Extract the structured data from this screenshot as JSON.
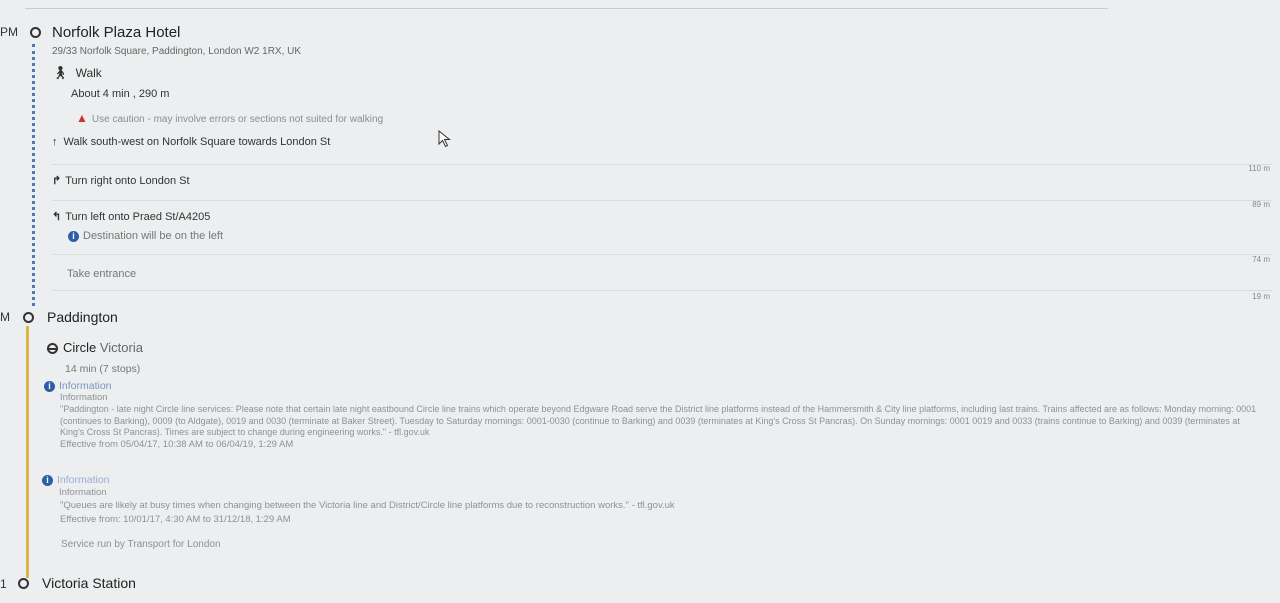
{
  "journey": {
    "origin": {
      "time_suffix": "PM",
      "name": "Norfolk Plaza Hotel",
      "address": "29/33 Norfolk Square, Paddington, London W2 1RX, UK"
    },
    "walk": {
      "mode_label": "Walk",
      "summary": "About 4 min , 290 m",
      "caution": "Use caution - may involve errors or sections not suited for walking",
      "steps": [
        {
          "text": "Walk south-west on Norfolk Square towards London St",
          "icon": "arrow-up-icon",
          "distance": "110 m"
        },
        {
          "text": "Turn right onto London St",
          "icon": "turn-right-icon",
          "distance": "89 m"
        },
        {
          "text": "Turn left onto Praed St/A4205",
          "icon": "turn-left-icon",
          "note": "Destination will be on the left",
          "distance": "74 m"
        },
        {
          "text": "Take entrance",
          "icon": "",
          "distance": "19 m"
        }
      ]
    },
    "transfer": {
      "time_suffix": "M",
      "name": "Paddington",
      "line": "Circle",
      "direction": "Victoria",
      "duration": "14 min (7 stops)",
      "alerts": [
        {
          "heading": "Information",
          "subheading": "Information",
          "body": "\"Paddington - late night Circle line services: Please note that certain late night eastbound Circle line trains which operate beyond Edgware Road serve the District line platforms instead of the Hammersmith & City line platforms, including last trains. Trains affected are as follows: Monday morning: 0001 (continues to Barking), 0009 (to Aldgate), 0019 and 0030 (terminate at Baker Street). Tuesday to Saturday mornings: 0001-0030 (continue to Barking) and 0039 (terminates at King's Cross St Pancras). On Sunday mornings: 0001 0019 and 0033 (trains continue to Barking) and 0039 (terminates at King's Cross St Pancras). Times are subject to change during engineering works.\" - tfl.gov.uk",
          "effective": "Effective from 05/04/17, 10:38 AM to 06/04/19, 1:29 AM"
        },
        {
          "heading": "Information",
          "subheading": "Information",
          "body": "\"Queues are likely at busy times when changing between the Victoria line and District/Circle line platforms due to reconstruction works.\" - tfl.gov.uk",
          "effective": "Effective from: 10/01/17, 4:30 AM to 31/12/18, 1:29 AM"
        }
      ],
      "operator": "Service run by Transport for London"
    },
    "destination": {
      "time_suffix": "1",
      "name": "Victoria Station"
    }
  },
  "colors": {
    "walk_line": "#4a79b8",
    "circle_line": "#d9b54c",
    "info": "#2d5fa8",
    "warning": "#c7372f",
    "underground_icon": "#333333"
  }
}
